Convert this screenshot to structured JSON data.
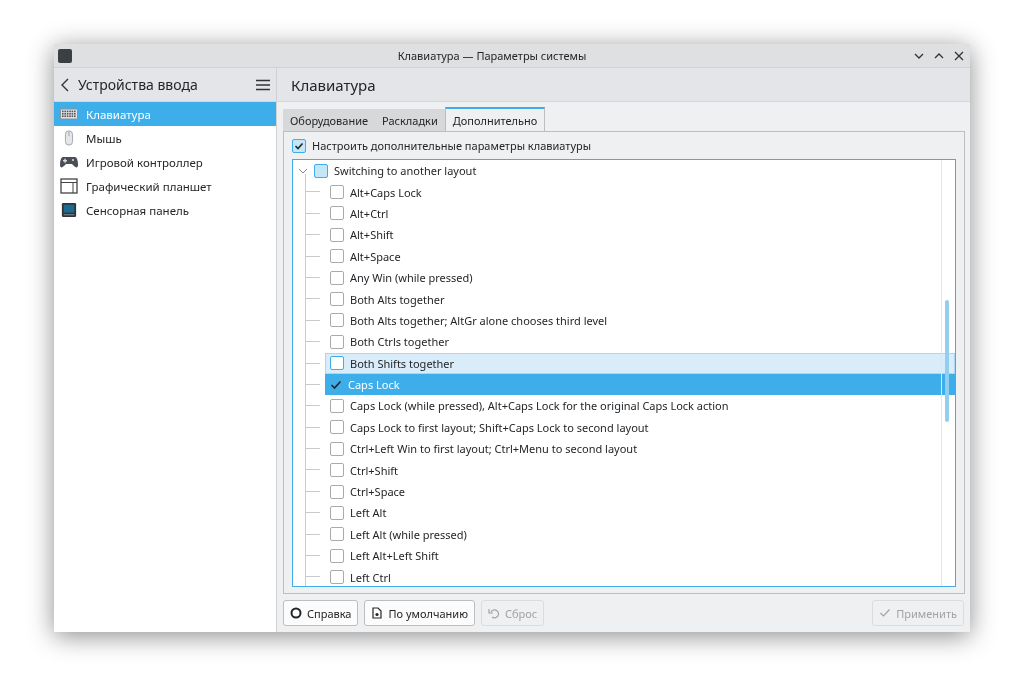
{
  "window": {
    "title": "Клавиатура — Параметры системы"
  },
  "sidebar": {
    "title": "Устройства ввода",
    "items": [
      {
        "label": "Клавиатура",
        "selected": true
      },
      {
        "label": "Мышь",
        "selected": false
      },
      {
        "label": "Игровой контроллер",
        "selected": false
      },
      {
        "label": "Графический планшет",
        "selected": false
      },
      {
        "label": "Сенсорная панель",
        "selected": false
      }
    ]
  },
  "page_title": "Клавиатура",
  "tabs": [
    {
      "label": "Оборудование",
      "selected": false
    },
    {
      "label": "Раскладки",
      "selected": false
    },
    {
      "label": "Дополнительно",
      "selected": true
    }
  ],
  "configure_checkbox": {
    "label": "Настроить дополнительные параметры клавиатуры",
    "checked": true
  },
  "tree": {
    "group": {
      "label": "Switching to another layout",
      "expanded": true
    },
    "items": [
      {
        "label": "Alt+Caps Lock",
        "checked": false,
        "selected": false,
        "hovered": false
      },
      {
        "label": "Alt+Ctrl",
        "checked": false,
        "selected": false,
        "hovered": false
      },
      {
        "label": "Alt+Shift",
        "checked": false,
        "selected": false,
        "hovered": false
      },
      {
        "label": "Alt+Space",
        "checked": false,
        "selected": false,
        "hovered": false
      },
      {
        "label": "Any Win (while pressed)",
        "checked": false,
        "selected": false,
        "hovered": false
      },
      {
        "label": "Both Alts together",
        "checked": false,
        "selected": false,
        "hovered": false
      },
      {
        "label": "Both Alts together; AltGr alone chooses third level",
        "checked": false,
        "selected": false,
        "hovered": false
      },
      {
        "label": "Both Ctrls together",
        "checked": false,
        "selected": false,
        "hovered": false
      },
      {
        "label": "Both Shifts together",
        "checked": false,
        "selected": false,
        "hovered": true
      },
      {
        "label": "Caps Lock",
        "checked": true,
        "selected": true,
        "hovered": false
      },
      {
        "label": "Caps Lock (while pressed), Alt+Caps Lock for the original Caps Lock action",
        "checked": false,
        "selected": false,
        "hovered": false
      },
      {
        "label": "Caps Lock to first layout; Shift+Caps Lock to second layout",
        "checked": false,
        "selected": false,
        "hovered": false
      },
      {
        "label": "Ctrl+Left Win to first layout; Ctrl+Menu to second layout",
        "checked": false,
        "selected": false,
        "hovered": false
      },
      {
        "label": "Ctrl+Shift",
        "checked": false,
        "selected": false,
        "hovered": false
      },
      {
        "label": "Ctrl+Space",
        "checked": false,
        "selected": false,
        "hovered": false
      },
      {
        "label": "Left Alt",
        "checked": false,
        "selected": false,
        "hovered": false
      },
      {
        "label": "Left Alt (while pressed)",
        "checked": false,
        "selected": false,
        "hovered": false
      },
      {
        "label": "Left Alt+Left Shift",
        "checked": false,
        "selected": false,
        "hovered": false
      },
      {
        "label": "Left Ctrl",
        "checked": false,
        "selected": false,
        "hovered": false
      }
    ]
  },
  "buttons": [
    {
      "label": "Справка",
      "disabled": false
    },
    {
      "label": "По умолчанию",
      "disabled": false
    },
    {
      "label": "Сброс",
      "disabled": true
    }
  ],
  "apply_button": {
    "label": "Применить",
    "disabled": true
  }
}
